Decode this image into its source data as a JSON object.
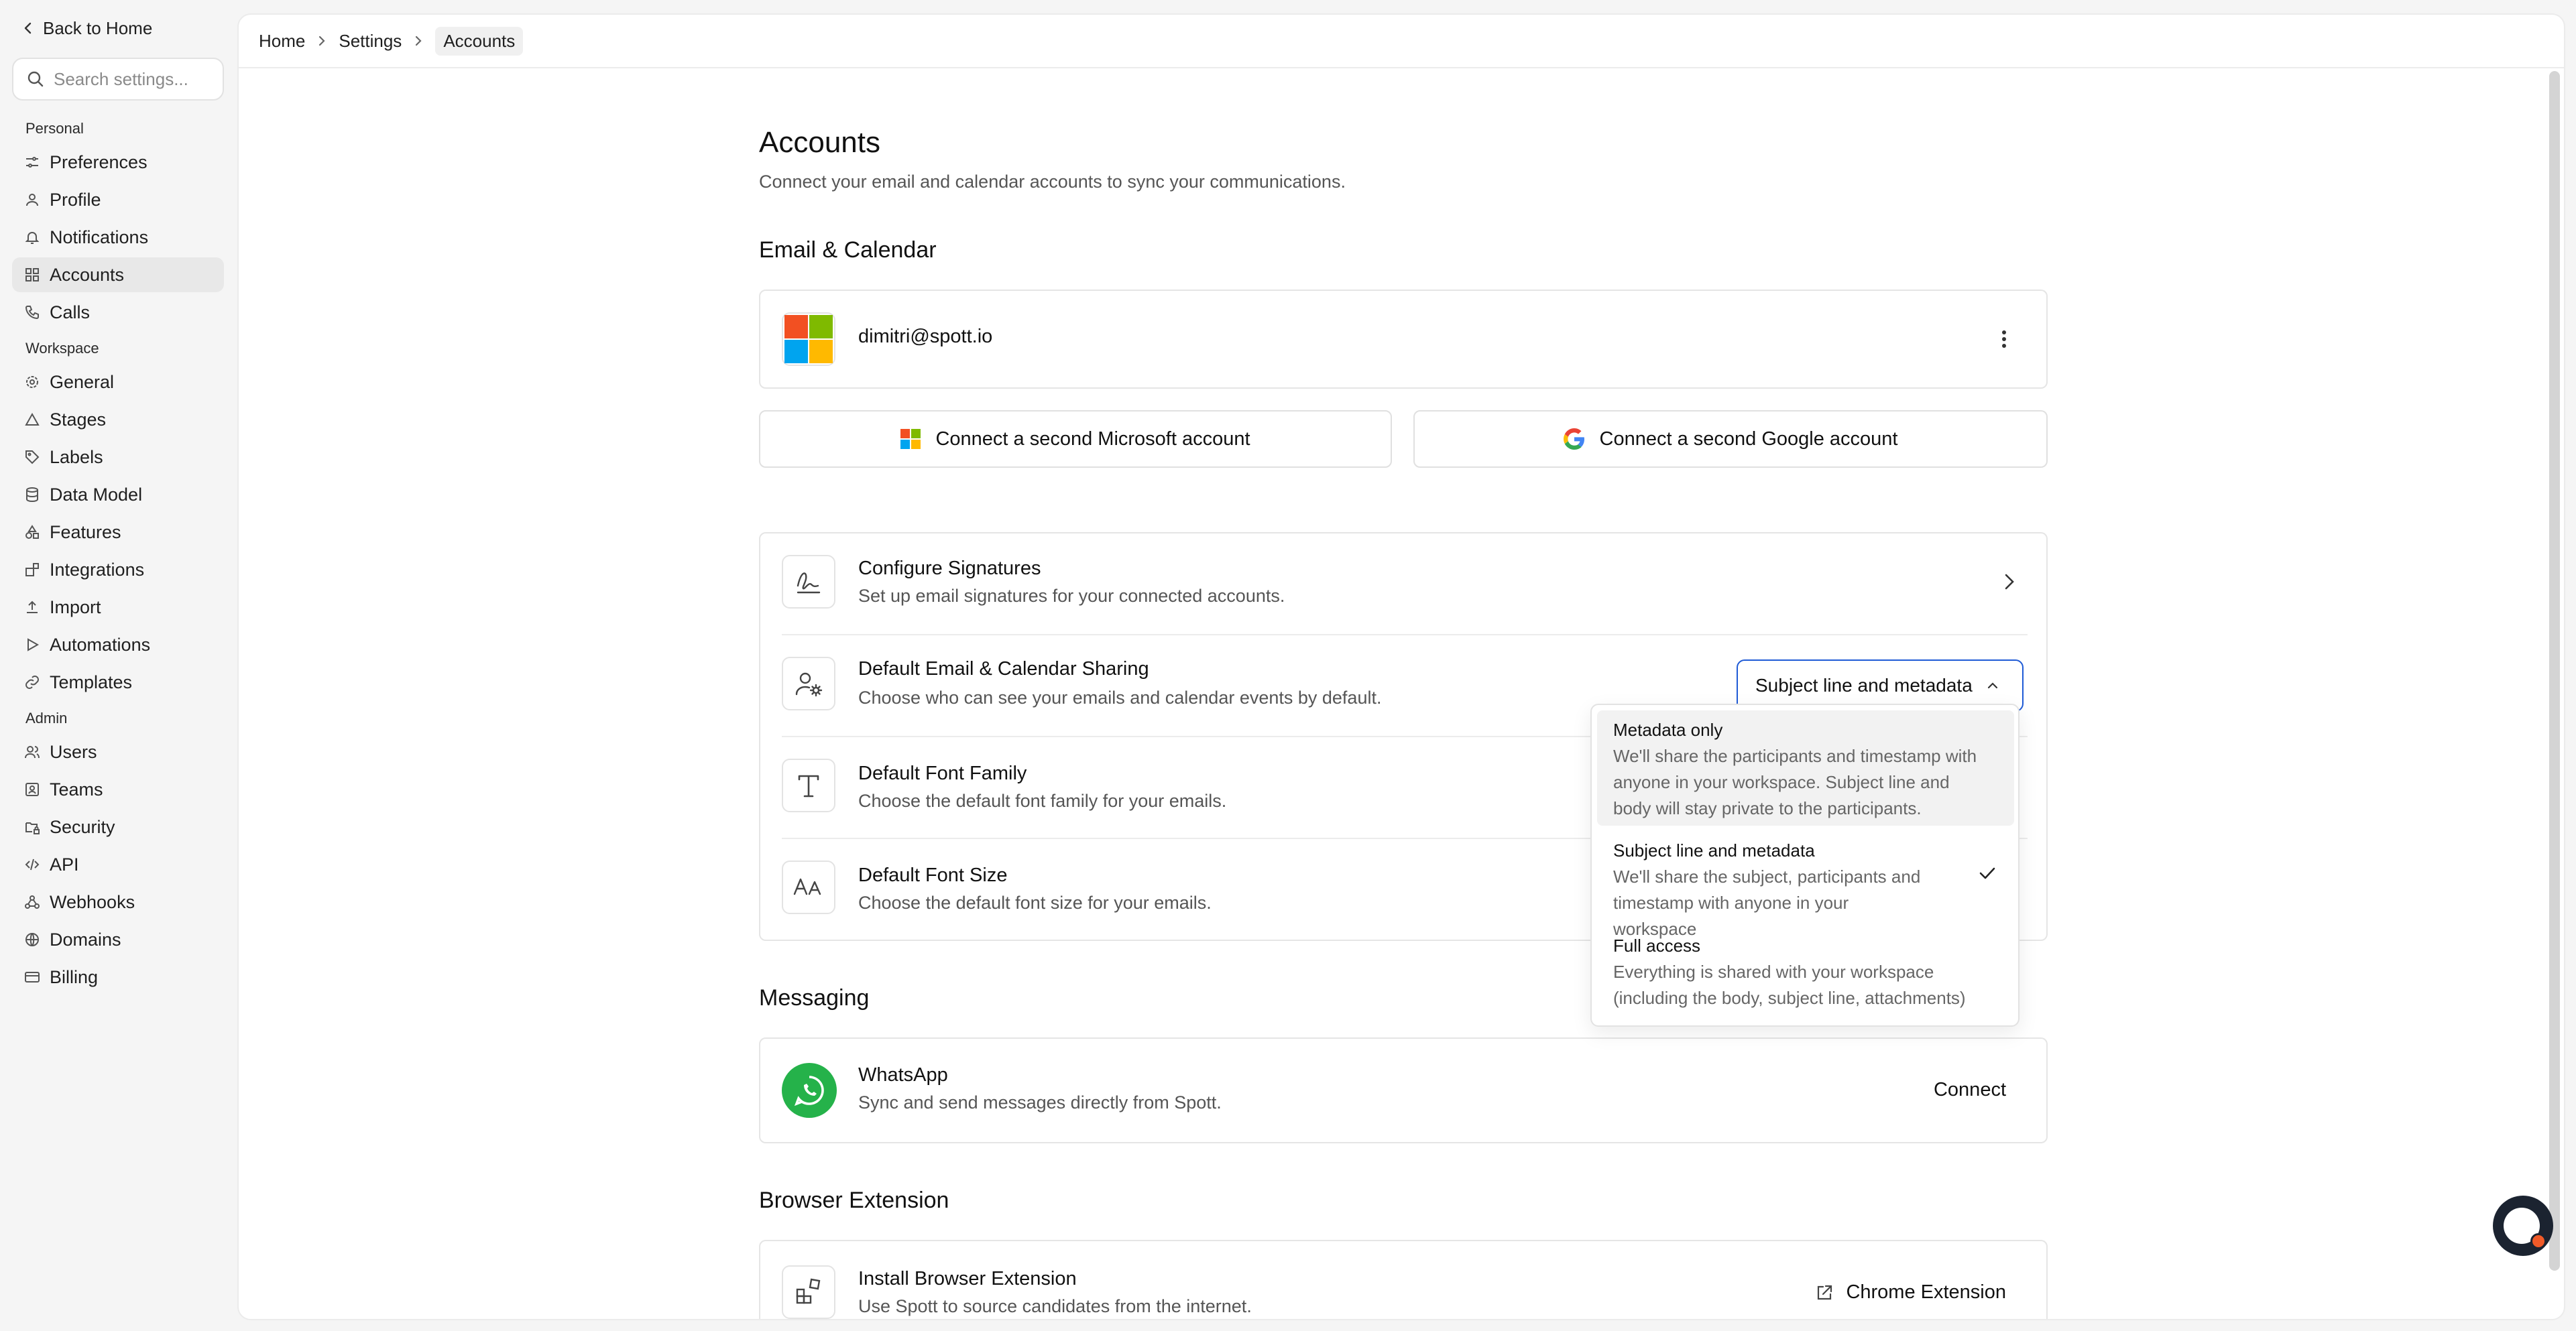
{
  "sidebar": {
    "back_label": "Back to Home",
    "search_placeholder": "Search settings...",
    "sections": {
      "personal": "Personal",
      "workspace": "Workspace",
      "admin": "Admin"
    },
    "personal_items": [
      "Preferences",
      "Profile",
      "Notifications",
      "Accounts",
      "Calls"
    ],
    "workspace_items": [
      "General",
      "Stages",
      "Labels",
      "Data Model",
      "Features",
      "Integrations",
      "Import",
      "Automations",
      "Templates"
    ],
    "admin_items": [
      "Users",
      "Teams",
      "Security",
      "API",
      "Webhooks",
      "Domains",
      "Billing"
    ]
  },
  "breadcrumb": {
    "home": "Home",
    "settings": "Settings",
    "current": "Accounts"
  },
  "page": {
    "title": "Accounts",
    "subtitle": "Connect your email and calendar accounts to sync your communications."
  },
  "email_calendar": {
    "heading": "Email & Calendar",
    "account_email": "dimitri@spott.io",
    "connect_microsoft": "Connect a second Microsoft account",
    "connect_google": "Connect a second Google account"
  },
  "settings_rows": {
    "signatures_title": "Configure Signatures",
    "signatures_desc": "Set up email signatures for your connected accounts.",
    "sharing_title": "Default Email & Calendar Sharing",
    "sharing_desc": "Choose who can see your emails and calendar events by default.",
    "sharing_value": "Subject line and metadata",
    "font_family_title": "Default Font Family",
    "font_family_desc": "Choose the default font family for your emails.",
    "font_size_title": "Default Font Size",
    "font_size_desc": "Choose the default font size for your emails."
  },
  "dropdown": {
    "options": [
      {
        "title": "Metadata only",
        "desc": "We'll share the participants and timestamp with anyone in your workspace. Subject line and body will stay private to the participants."
      },
      {
        "title": "Subject line and metadata",
        "desc": "We'll share the subject, participants and timestamp with anyone in your workspace"
      },
      {
        "title": "Full access",
        "desc": "Everything is shared with your workspace (including the body, subject line, attachments)"
      }
    ]
  },
  "messaging": {
    "heading": "Messaging",
    "whatsapp_title": "WhatsApp",
    "whatsapp_desc": "Sync and send messages directly from Spott.",
    "connect_label": "Connect"
  },
  "browser_extension": {
    "heading": "Browser Extension",
    "title": "Install Browser Extension",
    "desc": "Use Spott to source candidates from the internet.",
    "link_label": "Chrome Extension"
  },
  "colors": {
    "accent": "#1f5bd6",
    "whatsapp": "#25b24a",
    "ms_red": "#f25022",
    "ms_green": "#7fba00",
    "ms_blue": "#00a4ef",
    "ms_yellow": "#ffb900",
    "chat_dot": "#f05a28"
  }
}
